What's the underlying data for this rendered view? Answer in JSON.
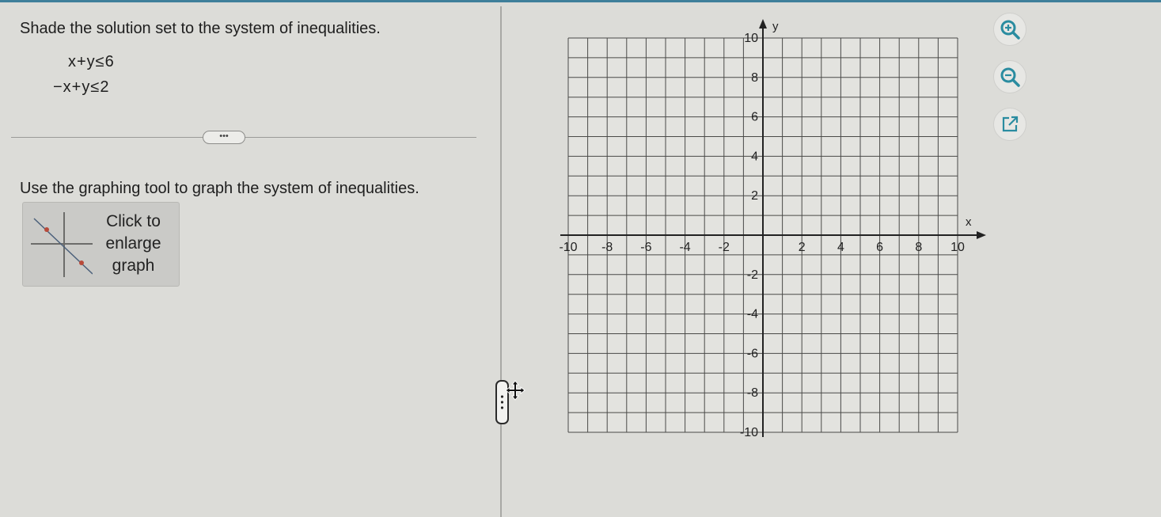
{
  "problem": {
    "prompt": "Shade the solution set to the system of inequalities.",
    "inequalities": [
      "x+y≤6",
      "−x+y≤2"
    ],
    "more_button_label": "•••",
    "instruction": "Use the graphing tool to graph the system of inequalities."
  },
  "enlarge": {
    "label_line1": "Click to",
    "label_line2": "enlarge",
    "label_line3": "graph"
  },
  "graph": {
    "x_label": "x",
    "y_label": "y",
    "x_range": [
      -10,
      10
    ],
    "y_range": [
      -10,
      10
    ],
    "grid_step": 1,
    "x_tick_labels": [
      "-10",
      "-8",
      "-6",
      "-4",
      "-2",
      "2",
      "4",
      "6",
      "8",
      "10"
    ],
    "y_tick_labels": [
      "10",
      "8",
      "6",
      "4",
      "2",
      "-2",
      "-4",
      "-6",
      "-8",
      "-10"
    ]
  },
  "tools": {
    "zoom_in": "zoom-in-icon",
    "zoom_out": "zoom-out-icon",
    "open_external": "external-link-icon",
    "accent_color": "#2a8ca0"
  }
}
